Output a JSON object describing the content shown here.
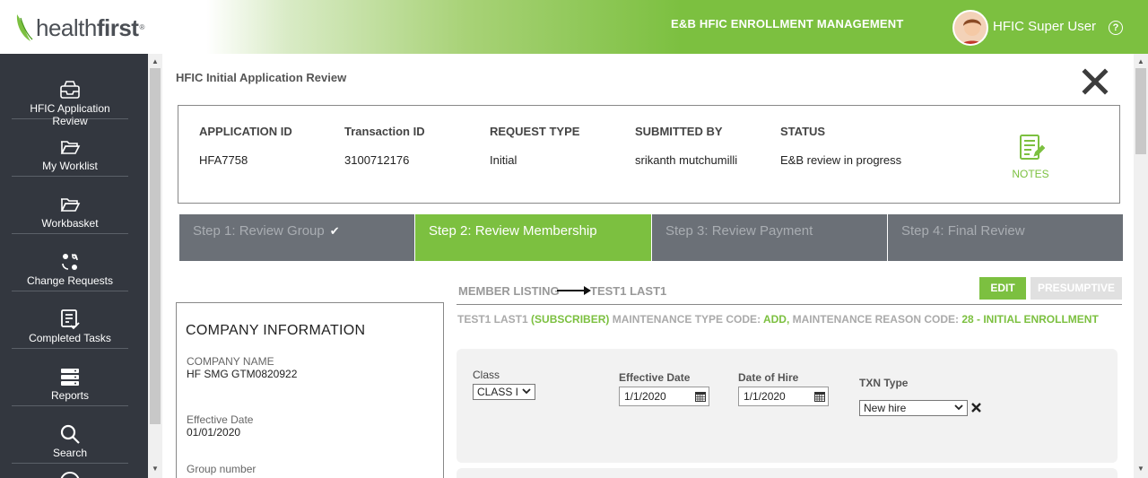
{
  "header": {
    "logo_light": "health",
    "logo_bold": "first",
    "logo_tm": "®",
    "app_title": "E&B HFIC ENROLLMENT MANAGEMENT",
    "user_name": "HFIC Super User",
    "help_glyph": "?"
  },
  "sidebar": {
    "items": [
      {
        "label": "HFIC Application Review",
        "icon": "inbox-icon"
      },
      {
        "label": "My Worklist",
        "icon": "folder-open-icon"
      },
      {
        "label": "Workbasket",
        "icon": "folder-open-icon"
      },
      {
        "label": "Change Requests",
        "icon": "change-requests-icon"
      },
      {
        "label": "Completed Tasks",
        "icon": "completed-tasks-icon"
      },
      {
        "label": "Reports",
        "icon": "reports-icon"
      },
      {
        "label": "Search",
        "icon": "search-icon"
      }
    ]
  },
  "page": {
    "title": "HFIC Initial Application Review"
  },
  "summary": {
    "headers": [
      "APPLICATION ID",
      "Transaction ID",
      "REQUEST TYPE",
      "SUBMITTED BY",
      "STATUS"
    ],
    "values": [
      "HFA7758",
      "3100712176",
      "Initial",
      "srikanth mutchumilli",
      "E&B review in progress"
    ],
    "notes_label": "NOTES"
  },
  "steps": [
    {
      "label": "Step 1: Review Group",
      "done_mark": "✔",
      "state": "done"
    },
    {
      "label": "Step 2: Review Membership",
      "state": "active"
    },
    {
      "label": "Step 3: Review Payment",
      "state": "pending"
    },
    {
      "label": "Step 4: Final Review",
      "state": "pending"
    }
  ],
  "company": {
    "heading": "COMPANY INFORMATION",
    "name_label": "COMPANY NAME",
    "name_value": "HF SMG GTM0820922",
    "eff_label": "Effective Date",
    "eff_value": "01/01/2020",
    "group_label": "Group number"
  },
  "member": {
    "listing_label": "MEMBER LISTING",
    "member_name": "TEST1 LAST1",
    "edit_label": "EDIT",
    "presumptive_label": "PRESUMPTIVE",
    "info": {
      "name": "TEST1 LAST1",
      "role": "(SUBSCRIBER)",
      "mt_label": "MAINTENANCE TYPE CODE:",
      "mt_value": "ADD,",
      "mr_label": "MAINTENANCE REASON CODE:",
      "mr_value": "28 - INITIAL ENROLLMENT"
    },
    "form": {
      "class_label": "Class",
      "class_value": "CLASS I",
      "eff_label": "Effective Date",
      "eff_value": "1/1/2020",
      "hire_label": "Date of Hire",
      "hire_value": "1/1/2020",
      "txn_label": "TXN Type",
      "txn_value": "New hire"
    }
  },
  "colors": {
    "brand_green": "#7cc040",
    "sidebar_bg": "#33373f",
    "step_inactive": "#6b7077"
  }
}
